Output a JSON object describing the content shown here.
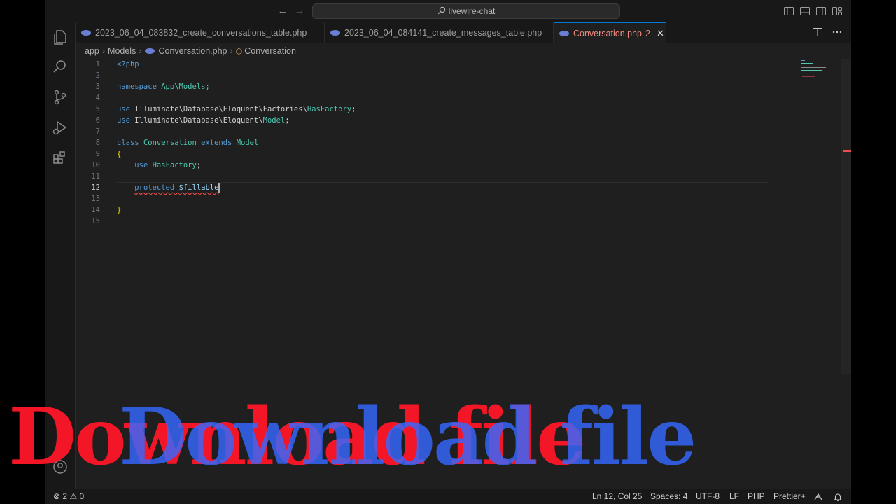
{
  "titlebar": {
    "search_text": "livewire-chat",
    "nav_back_icon": "arrow-left",
    "nav_forward_icon": "arrow-right"
  },
  "tabs": [
    {
      "label": "2023_06_04_083832_create_conversations_table.php",
      "icon": "php-icon"
    },
    {
      "label": "2023_06_04_084141_create_messages_table.php",
      "icon": "php-icon"
    },
    {
      "label": "Conversation.php",
      "icon": "php-icon",
      "problems": "2",
      "close": "✕",
      "active": true
    }
  ],
  "breadcrumbs": {
    "folder1": "app",
    "folder2": "Models",
    "file": "Conversation.php",
    "symbol": "Conversation",
    "sep": "›"
  },
  "editor": {
    "line_numbers": [
      "1",
      "2",
      "3",
      "4",
      "5",
      "6",
      "7",
      "8",
      "9",
      "10",
      "11",
      "12",
      "13",
      "14",
      "15"
    ],
    "current_line": "12",
    "code": {
      "l1": "<?php",
      "l3_kw": "namespace",
      "l3_ns": "App\\Models;",
      "l5_kw": "use",
      "l5_path": "Illuminate\\Database\\Eloquent\\Factories\\",
      "l5_cls": "HasFactory",
      "l5_end": ";",
      "l6_kw": "use",
      "l6_path": "Illuminate\\Database\\Eloquent\\",
      "l6_cls": "Model",
      "l6_end": ";",
      "l8_kw": "class",
      "l8_name": "Conversation",
      "l8_ext": "extends",
      "l8_parent": "Model",
      "l9": "{",
      "l10_kw": "use",
      "l10_cls": "HasFactory",
      "l10_end": ";",
      "l12_kw": "protected",
      "l12_var": "$fillable",
      "l14": "}"
    }
  },
  "watermark": {
    "red_text": "Download file",
    "blue_text": "Download file"
  },
  "statusbar": {
    "errors": "2",
    "warnings": "0",
    "position": "Ln 12, Col 25",
    "spaces": "Spaces: 4",
    "encoding": "UTF-8",
    "eol": "LF",
    "language": "PHP",
    "formatter": "Prettier"
  },
  "colors": {
    "accent": "#0078d4",
    "error": "#f14c4c",
    "tab_active_text": "#f38a7d",
    "watermark_red": "#ff1628",
    "watermark_blue": "#3468ff"
  }
}
